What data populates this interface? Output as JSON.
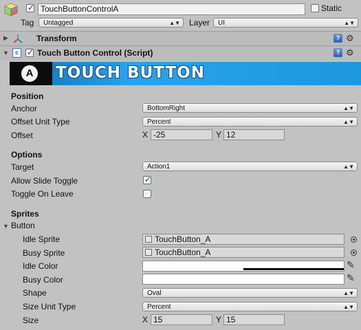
{
  "object": {
    "name": "TouchButtonControlA",
    "active": true,
    "static_label": "Static",
    "static_checked": false,
    "tag_label": "Tag",
    "tag_value": "Untagged",
    "layer_label": "Layer",
    "layer_value": "UI"
  },
  "components": {
    "transform": "Transform",
    "script": "Touch Button Control (Script)",
    "script_enabled": true
  },
  "banner": {
    "letter": "A",
    "title": "TOUCH BUTTON"
  },
  "position": {
    "section": "Position",
    "anchor_label": "Anchor",
    "anchor_value": "BottomRight",
    "offset_unit_label": "Offset Unit Type",
    "offset_unit_value": "Percent",
    "offset_label": "Offset",
    "x_label": "X",
    "x_value": "-25",
    "y_label": "Y",
    "y_value": "12"
  },
  "options": {
    "section": "Options",
    "target_label": "Target",
    "target_value": "Action1",
    "allow_slide_label": "Allow Slide Toggle",
    "allow_slide_checked": true,
    "toggle_leave_label": "Toggle On Leave",
    "toggle_leave_checked": false
  },
  "sprites": {
    "section": "Sprites",
    "button_foldout": "Button",
    "idle_sprite_label": "Idle Sprite",
    "idle_sprite_value": "TouchButton_A",
    "busy_sprite_label": "Busy Sprite",
    "busy_sprite_value": "TouchButton_A",
    "idle_color_label": "Idle Color",
    "busy_color_label": "Busy Color",
    "shape_label": "Shape",
    "shape_value": "Oval",
    "size_unit_label": "Size Unit Type",
    "size_unit_value": "Percent",
    "size_label": "Size",
    "size_x_label": "X",
    "size_x_value": "15",
    "size_y_label": "Y",
    "size_y_value": "15"
  },
  "colors": {
    "background": "#c2c2c2",
    "banner_blue": "#1d97de",
    "field": "#d8d8d8"
  }
}
